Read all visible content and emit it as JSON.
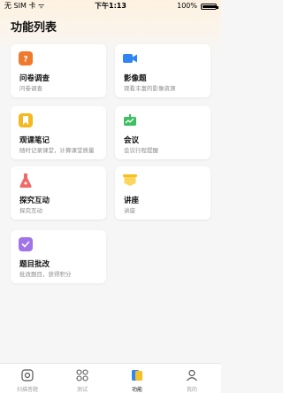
{
  "status_bar": {
    "carrier": "无 SIM 卡 ᯤ",
    "time": "下午1:13",
    "battery": "100%",
    "battery_level": 1.0
  },
  "page": {
    "title": "功能列表"
  },
  "cards": [
    {
      "name": "问卷调查",
      "desc": "问卷调查",
      "icon": "question-icon",
      "color": "#f07a2c"
    },
    {
      "name": "影像题",
      "desc": "观看丰富的影像资源",
      "icon": "video-camera-icon",
      "color": "#2f86f3"
    },
    {
      "name": "观课笔记",
      "desc": "随时记录课堂，计算课堂质量",
      "icon": "bookmark-icon",
      "color": "#f5b81e"
    },
    {
      "name": "会议",
      "desc": "会议行程提醒",
      "icon": "chart-board-icon",
      "color": "#3cbf63"
    },
    {
      "name": "探究互动",
      "desc": "探究互动",
      "icon": "flask-icon",
      "color": "#f06a6a"
    },
    {
      "name": "讲座",
      "desc": "讲座",
      "icon": "banner-icon",
      "color": "#f6c023"
    },
    {
      "name": "题目批改",
      "desc": "批改题目，获得积分",
      "icon": "check-icon",
      "color": "#a173e8"
    }
  ],
  "tabbar": [
    {
      "label": "扫描答题",
      "icon": "scan-icon",
      "active": false
    },
    {
      "label": "测试",
      "icon": "grid-icon",
      "active": false
    },
    {
      "label": "功能",
      "icon": "function-icon",
      "active": true
    },
    {
      "label": "我的",
      "icon": "user-icon",
      "active": false
    }
  ]
}
